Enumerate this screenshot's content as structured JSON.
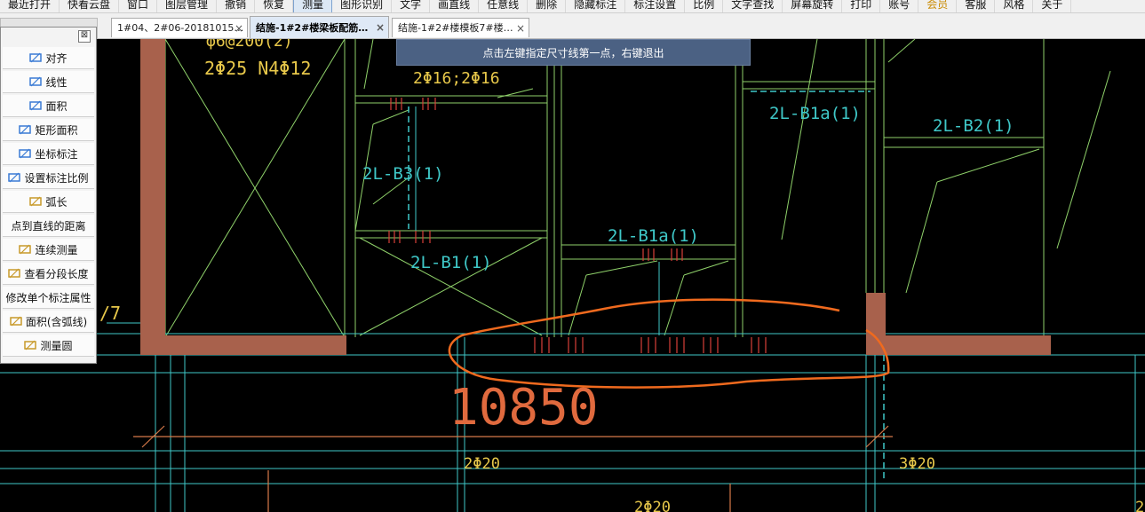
{
  "menu": [
    "最近打开",
    "快看云盘",
    "窗口",
    "图层管理",
    "撤销",
    "恢复",
    "测量",
    "图形识别",
    "文字",
    "画直线",
    "任意线",
    "删除",
    "隐藏标注",
    "标注设置",
    "比例",
    "文字查找",
    "屏幕旋转",
    "打印",
    "账号",
    "会员",
    "客服",
    "风格",
    "关于"
  ],
  "tabs": [
    {
      "label": "1#04、2#06-20181015…",
      "close": "×"
    },
    {
      "label": "结施-1#2#楼梁板配筋…",
      "close": "×"
    },
    {
      "label": "结施-1#2#楼模板7#楼…",
      "close": "×"
    }
  ],
  "hint": "点击左键指定尺寸线第一点，右键退出",
  "panel": {
    "close": "⊠",
    "items": [
      {
        "label": "对齐",
        "icon": "align-icon"
      },
      {
        "label": "线性",
        "icon": "linear-dimension-icon"
      },
      {
        "label": "面积",
        "icon": "area-icon"
      },
      {
        "label": "矩形面积",
        "icon": "rect-area-icon"
      },
      {
        "label": "坐标标注",
        "icon": "coordinate-icon"
      },
      {
        "label": "设置标注比例",
        "icon": "scale-icon"
      },
      {
        "label": "弧长",
        "icon": "arc-length-icon"
      },
      {
        "label": "点到直线的距离",
        "icon": ""
      },
      {
        "label": "连续测量",
        "icon": "continuous-measure-icon"
      },
      {
        "label": "查看分段长度",
        "icon": "segment-icon"
      },
      {
        "label": "修改单个标注属性",
        "icon": ""
      },
      {
        "label": "面积(含弧线)",
        "icon": "arc-area-icon"
      },
      {
        "label": "测量圆",
        "icon": "circle-measure-icon"
      }
    ]
  },
  "drawing": {
    "t1": "φ6@200(2)",
    "t2": "2Φ25   N4Φ12",
    "t3": "2Φ16;2Φ16",
    "t4": "2L-B1a(1)",
    "t5": "2L-B2(1)",
    "t6": "2L-B3(1)",
    "t7": "2L-B1a(1)",
    "t8": "2L-B1(1)",
    "t9": "10850",
    "t10": "2Φ20",
    "t11": "3Φ20",
    "t12": "2Φ20",
    "t13": "/7",
    "t14": "2"
  },
  "colors": {
    "wall": "#a8614c",
    "cyan": "#3fc8c8",
    "green": "#8fd16a",
    "red": "#d8403a",
    "orange": "#f06a1e",
    "dim": "#d87a4a"
  }
}
